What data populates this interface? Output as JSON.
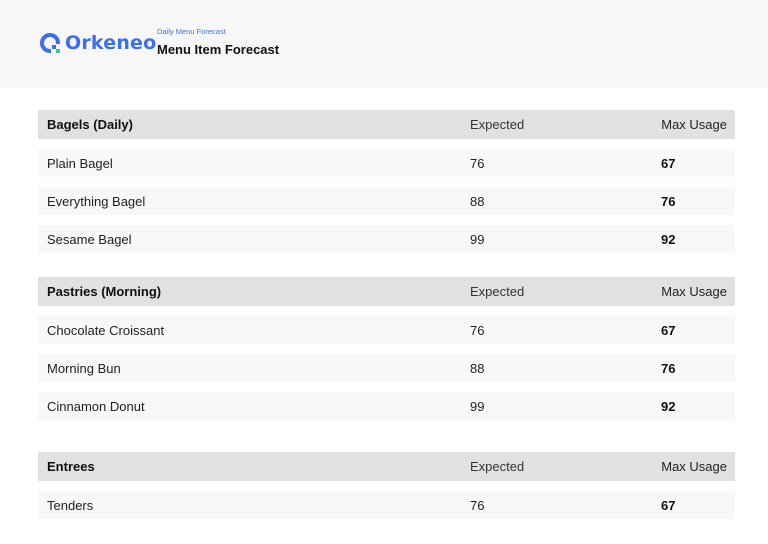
{
  "brand": {
    "name": "Orkeneo",
    "color": "#3b6ff0"
  },
  "header": {
    "kicker": "Daily Menu Forecast",
    "title": "Menu Item Forecast"
  },
  "sections": [
    {
      "title": "Bagels (Daily)",
      "col_expected": "Expected",
      "col_max": "Max Usage",
      "rows": [
        {
          "item": "Plain Bagel",
          "expected": "76",
          "max": "67"
        },
        {
          "item": "Everything Bagel",
          "expected": "88",
          "max": "76"
        },
        {
          "item": "Sesame Bagel",
          "expected": "99",
          "max": "92"
        }
      ]
    },
    {
      "title": "Pastries (Morning)",
      "col_expected": "Expected",
      "col_max": "Max Usage",
      "rows": [
        {
          "item": "Chocolate Croissant",
          "expected": "76",
          "max": "67"
        },
        {
          "item": "Morning Bun",
          "expected": "88",
          "max": "76"
        },
        {
          "item": "Cinnamon Donut",
          "expected": "99",
          "max": "92"
        }
      ]
    },
    {
      "title": "Entrees",
      "col_expected": "Expected",
      "col_max": "Max Usage",
      "rows": [
        {
          "item": "Tenders",
          "expected": "76",
          "max": "67"
        }
      ]
    }
  ]
}
